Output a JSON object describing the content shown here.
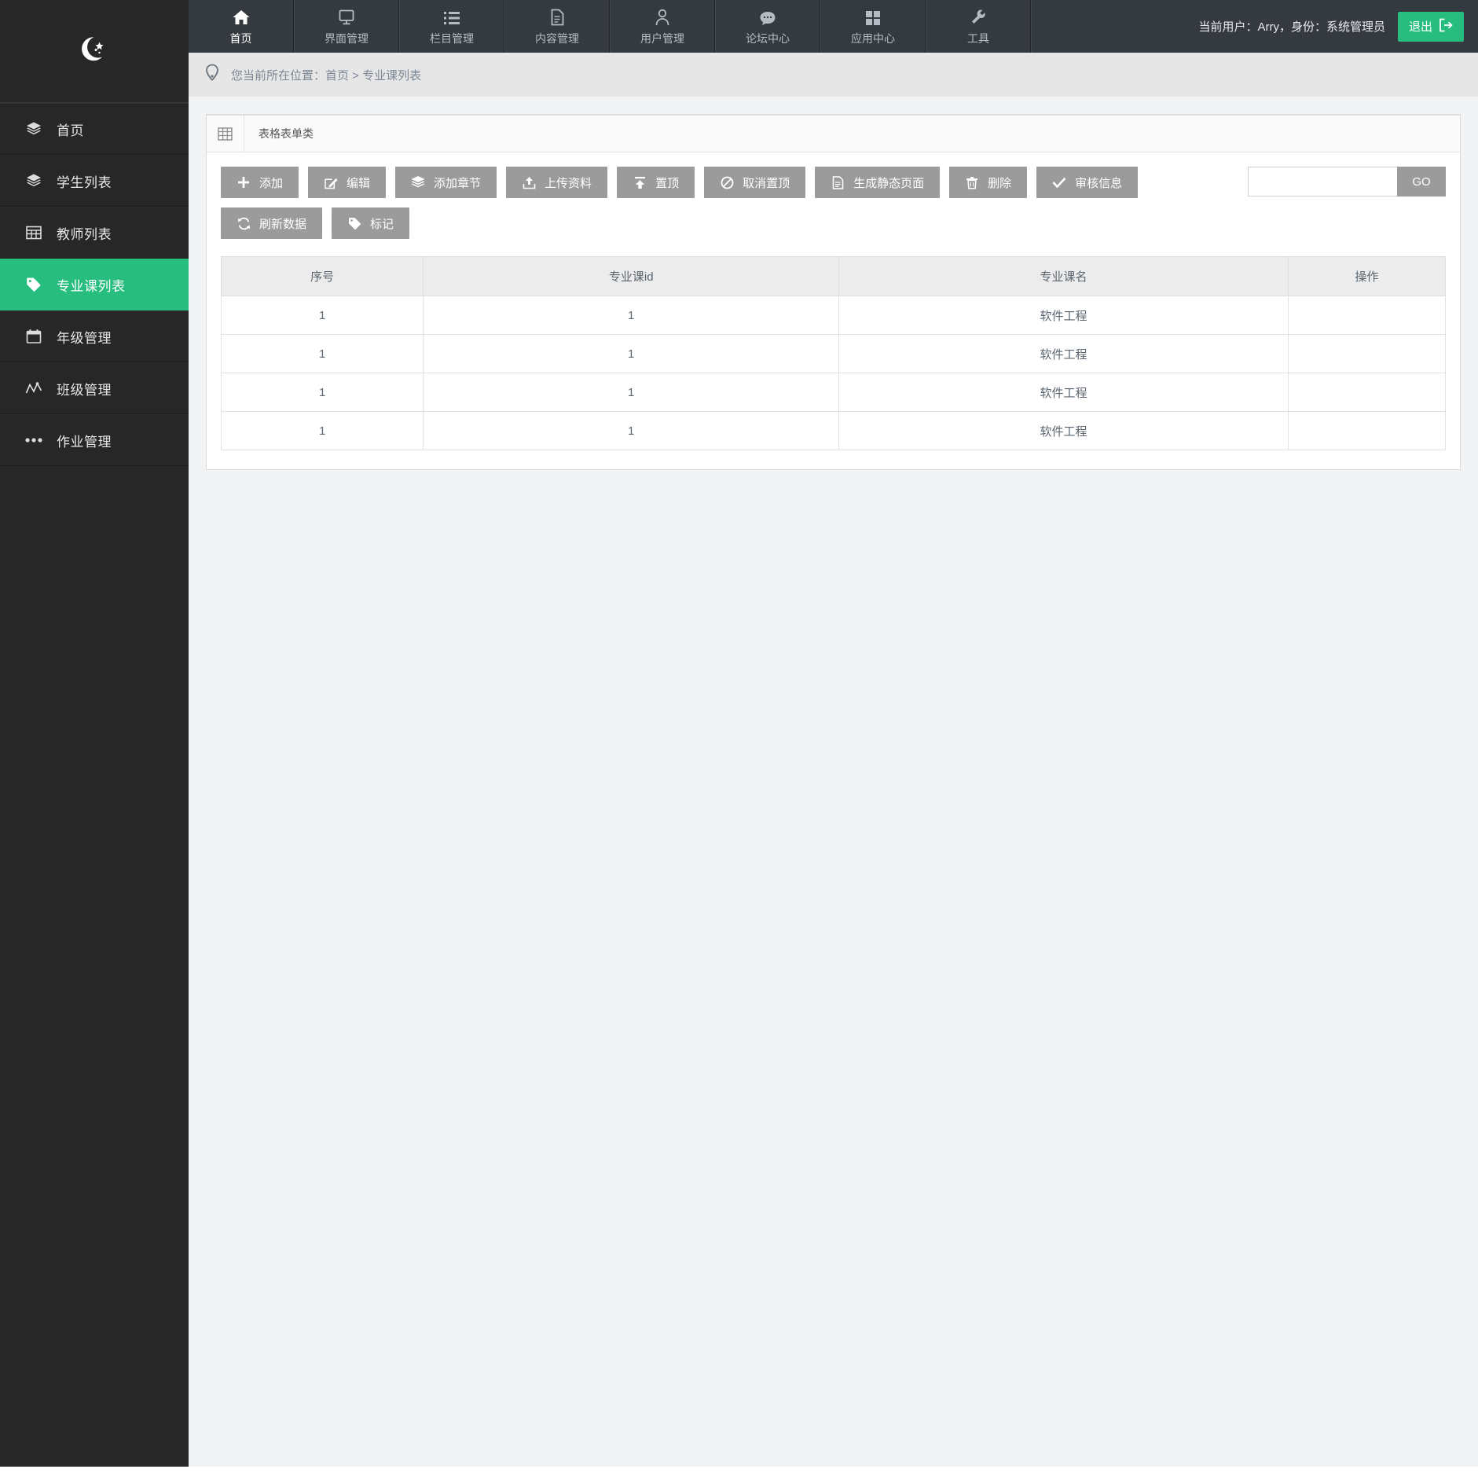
{
  "brand": {
    "logo_icon": "crescent-moon-stars-icon"
  },
  "topnav": {
    "items": [
      {
        "label": "首页",
        "icon": "home-icon",
        "active": true
      },
      {
        "label": "界面管理",
        "icon": "monitor-icon",
        "active": false
      },
      {
        "label": "栏目管理",
        "icon": "list-icon",
        "active": false
      },
      {
        "label": "内容管理",
        "icon": "document-icon",
        "active": false
      },
      {
        "label": "用户管理",
        "icon": "user-icon",
        "active": false
      },
      {
        "label": "论坛中心",
        "icon": "comment-icon",
        "active": false
      },
      {
        "label": "应用中心",
        "icon": "grid-icon",
        "active": false
      },
      {
        "label": "工具",
        "icon": "wrench-icon",
        "active": false
      }
    ],
    "user_info": "当前用户：Arry，身份：系统管理员",
    "logout_label": "退出",
    "logout_icon": "sign-out-icon",
    "accent_color": "#26bd7f",
    "bar_color": "#343a40"
  },
  "breadcrumb": {
    "icon": "location-pin-icon",
    "text": "您当前所在位置：首页 > 专业课列表"
  },
  "sidebar": {
    "bg_color": "#272727",
    "active_color": "#26bd7f",
    "items": [
      {
        "label": "首页",
        "icon": "layers-icon",
        "active": false
      },
      {
        "label": "学生列表",
        "icon": "layers-icon",
        "active": false
      },
      {
        "label": "教师列表",
        "icon": "table-grid-icon",
        "active": false
      },
      {
        "label": "专业课列表",
        "icon": "tag-icon",
        "active": true
      },
      {
        "label": "年级管理",
        "icon": "calendar-icon",
        "active": false
      },
      {
        "label": "班级管理",
        "icon": "chart-line-icon",
        "active": false
      },
      {
        "label": "作业管理",
        "icon": "ellipsis-icon",
        "active": false
      }
    ]
  },
  "panel": {
    "icon": "table-grid-icon",
    "title": "表格表单类"
  },
  "toolbar": {
    "buttons": [
      {
        "label": "添加",
        "icon": "plus-icon"
      },
      {
        "label": "编辑",
        "icon": "pencil-square-icon"
      },
      {
        "label": "添加章节",
        "icon": "layers-icon"
      },
      {
        "label": "上传资料",
        "icon": "upload-icon"
      },
      {
        "label": "置顶",
        "icon": "arrow-up-bar-icon"
      },
      {
        "label": "取消置顶",
        "icon": "ban-icon"
      },
      {
        "label": "生成静态页面",
        "icon": "file-text-icon"
      },
      {
        "label": "删除",
        "icon": "trash-icon"
      },
      {
        "label": "审核信息",
        "icon": "check-icon"
      },
      {
        "label": "刷新数据",
        "icon": "refresh-icon"
      },
      {
        "label": "标记",
        "icon": "tag-icon"
      }
    ],
    "button_color": "#9b9b9b"
  },
  "search": {
    "value": "",
    "placeholder": "",
    "go_label": "GO"
  },
  "table": {
    "columns": [
      "序号",
      "专业课id",
      "专业课名",
      "操作"
    ],
    "rows": [
      {
        "index": "1",
        "course_id": "1",
        "course_name": "软件工程",
        "action": ""
      },
      {
        "index": "1",
        "course_id": "1",
        "course_name": "软件工程",
        "action": ""
      },
      {
        "index": "1",
        "course_id": "1",
        "course_name": "软件工程",
        "action": ""
      },
      {
        "index": "1",
        "course_id": "1",
        "course_name": "软件工程",
        "action": ""
      }
    ]
  }
}
